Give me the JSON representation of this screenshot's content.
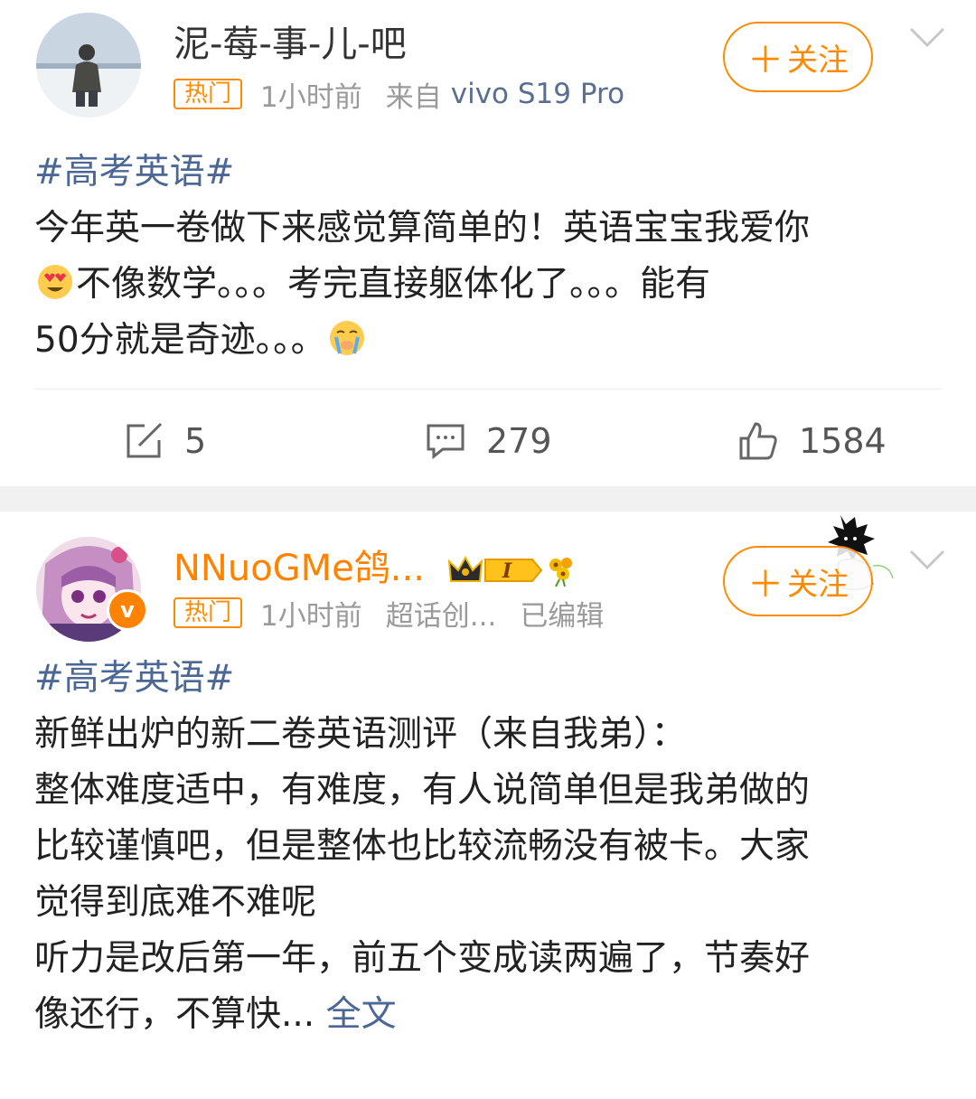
{
  "posts": [
    {
      "username": "泥-莓-事-儿-吧",
      "hot_badge": "热门",
      "time": "1小时前",
      "source_prefix": "来自",
      "source_device": "vivo S19 Pro",
      "follow_label": "关注",
      "tag": "#高考英语#",
      "lines": [
        "今年英一卷做下来感觉算简单的！英语宝宝我爱你",
        "不像数学。。。考完直接躯体化了。。。能有",
        "50分就是奇迹。。。"
      ],
      "emoji_1": "heart-eyes-emoji",
      "emoji_2": "crying-emoji",
      "reposts": "5",
      "comments": "279",
      "likes": "1584"
    },
    {
      "username": "NNuoGMe鸽...",
      "level_badge": "I",
      "hot_badge": "热门",
      "time": "1小时前",
      "meta_2": "超话创...",
      "meta_3": "已编辑",
      "follow_label": "关注",
      "verified_mark": "v",
      "tag": "#高考英语#",
      "lines": [
        "新鲜出炉的新二卷英语测评（来自我弟）：",
        "整体难度适中，有难度，有人说简单但是我弟做的",
        "比较谨慎吧，但是整体也比较流畅没有被卡。大家",
        "觉得到底难不难呢",
        "听力是改后第一年，前五个变成读两遍了，节奏好",
        "像还行，不算快..."
      ],
      "more_label": "全文"
    }
  ],
  "colors": {
    "accent": "#ff8a00",
    "link": "#4a6795",
    "meta": "#9a9a9a",
    "text": "#222222",
    "separator": "#f1f1f1"
  },
  "icons": {
    "repost": "repost-icon",
    "comment": "comment-icon",
    "like": "thumbs-up-icon",
    "more": "chevron-down-icon",
    "plus": "plus-icon"
  }
}
